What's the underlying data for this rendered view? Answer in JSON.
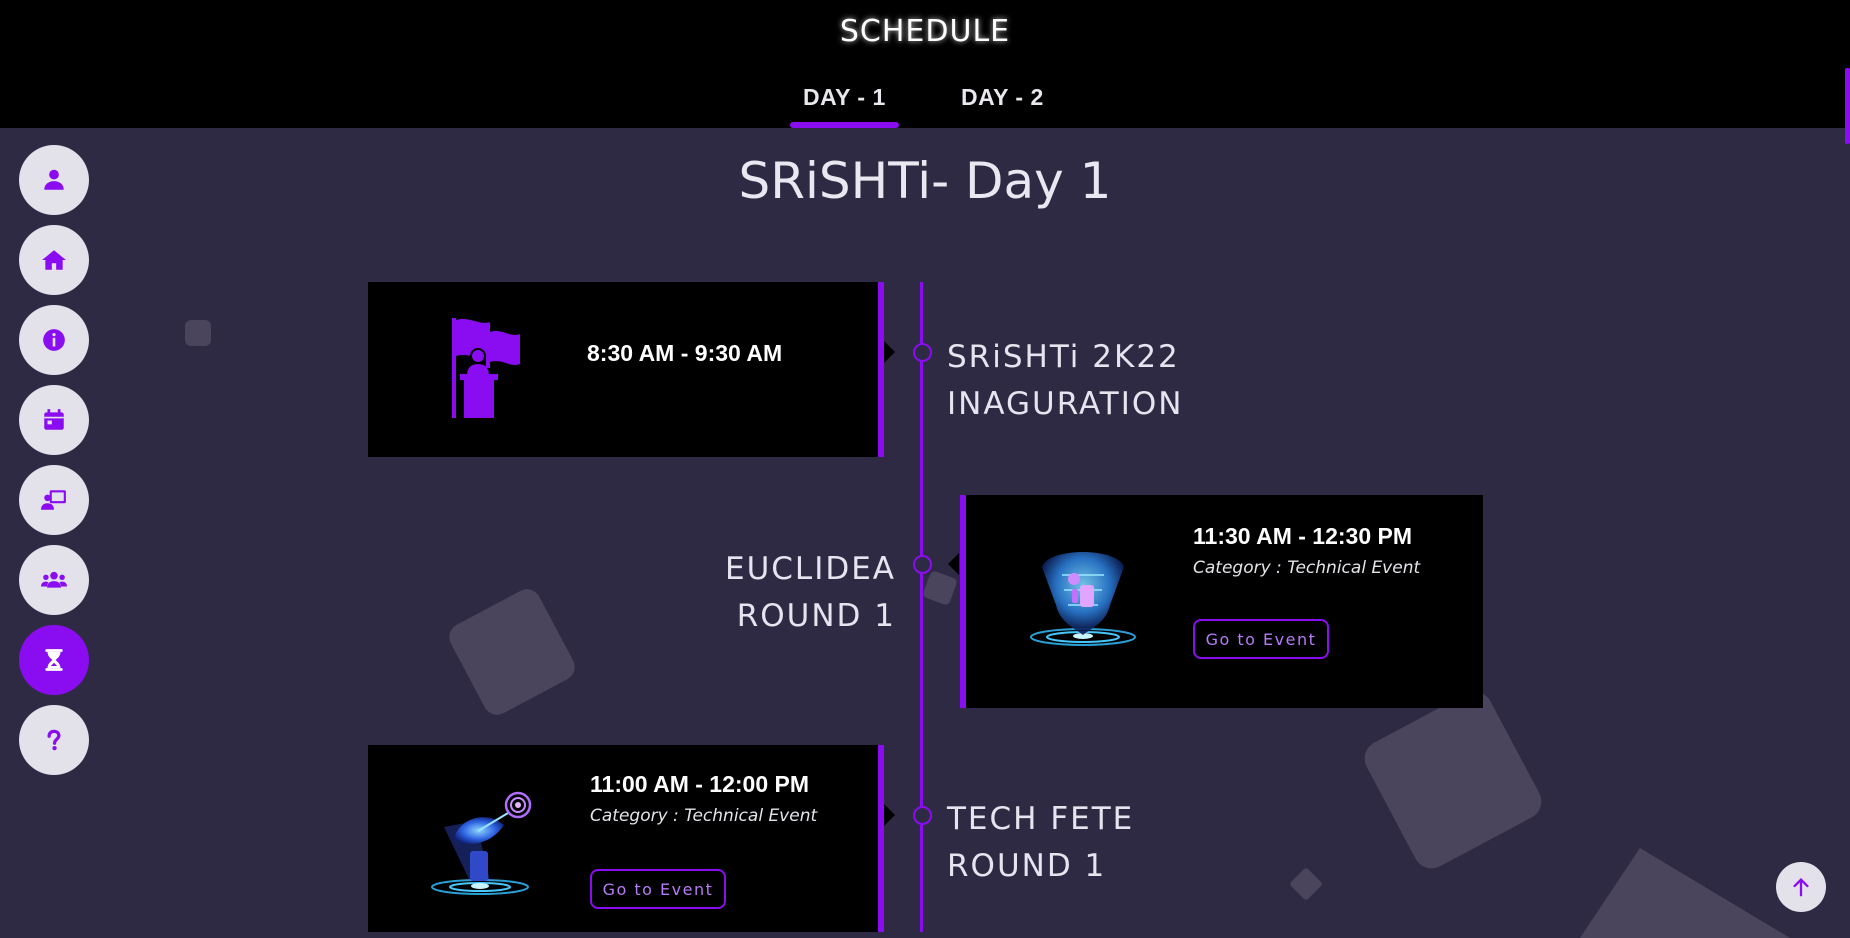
{
  "header": {
    "title": "SCHEDULE",
    "tabs": [
      {
        "label": "DAY - 1",
        "active": true
      },
      {
        "label": "DAY - 2",
        "active": false
      }
    ]
  },
  "sidebar": {
    "items": [
      {
        "name": "profile",
        "icon": "user-icon"
      },
      {
        "name": "home",
        "icon": "home-icon"
      },
      {
        "name": "about",
        "icon": "info-icon"
      },
      {
        "name": "events",
        "icon": "calendar-icon"
      },
      {
        "name": "workshops",
        "icon": "presentation-icon"
      },
      {
        "name": "team",
        "icon": "users-icon"
      },
      {
        "name": "schedule",
        "icon": "hourglass-icon",
        "active": true
      },
      {
        "name": "faq",
        "icon": "question-icon"
      }
    ]
  },
  "main": {
    "heading": "SRiSHTi- Day 1",
    "events": [
      {
        "name_line1": "SRiSHTi 2K22",
        "name_line2": "INAGURATION",
        "time": "8:30 AM - 9:30 AM",
        "image_icon": "flag-podium-icon"
      },
      {
        "name_line1": "EUCLIDEA",
        "name_line2": "ROUND 1",
        "time": "11:30 AM - 12:30 PM",
        "category": "Category : Technical Event",
        "button_label": "Go to Event",
        "image_icon": "hologram-robot-icon"
      },
      {
        "name_line1": "TECH FETE",
        "name_line2": "ROUND 1",
        "time": "11:00 AM - 12:00 PM",
        "category": "Category : Technical Event",
        "button_label": "Go to Event",
        "image_icon": "hologram-satellite-icon"
      }
    ]
  },
  "scroll_top": {
    "icon": "arrow-up-icon"
  },
  "colors": {
    "accent": "#8a0cf0",
    "background": "#2f2a44",
    "card": "#000000",
    "header": "#000000"
  }
}
